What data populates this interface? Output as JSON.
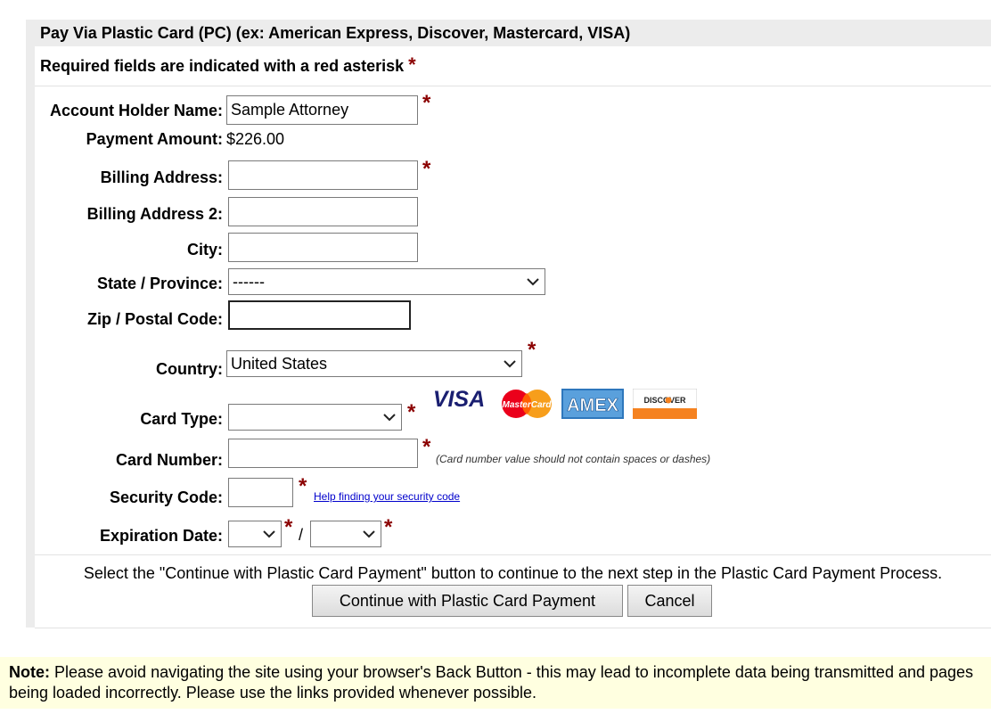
{
  "header": {
    "title": "Pay Via Plastic Card (PC) (ex: American Express, Discover, Mastercard, VISA)"
  },
  "required_note": "Required fields are indicated with a red asterisk",
  "asterisk": "*",
  "fields": {
    "account_holder": {
      "label": "Account Holder Name:",
      "value": "Sample Attorney"
    },
    "payment_amount": {
      "label": "Payment Amount:",
      "value": "$226.00"
    },
    "billing_address": {
      "label": "Billing Address:",
      "value": ""
    },
    "billing_address2": {
      "label": "Billing Address 2:",
      "value": ""
    },
    "city": {
      "label": "City:",
      "value": ""
    },
    "state": {
      "label": "State / Province:",
      "value": "------"
    },
    "zip": {
      "label": "Zip / Postal Code:",
      "value": ""
    },
    "country": {
      "label": "Country:",
      "value": "United States"
    },
    "card_type": {
      "label": "Card Type:",
      "value": ""
    },
    "card_number": {
      "label": "Card Number:",
      "value": "",
      "hint": "(Card number value should not contain spaces or dashes)"
    },
    "security_code": {
      "label": "Security Code:",
      "value": "",
      "help_link": "Help finding your security code"
    },
    "expiration": {
      "label": "Expiration Date:",
      "month": "",
      "year": "",
      "separator": "/"
    }
  },
  "card_logos": {
    "visa": "VISA",
    "mastercard": "MasterCard",
    "amex": "AMEX",
    "discover": "DISCOVER"
  },
  "instructions": "Select the \"Continue with Plastic Card Payment\" button to continue to the next step in the Plastic Card Payment Process.",
  "buttons": {
    "continue": "Continue with Plastic Card Payment",
    "cancel": "Cancel"
  },
  "note": {
    "prefix": "Note:",
    "text": " Please avoid navigating the site using your browser's Back Button - this may lead to incomplete data being transmitted and pages being loaded incorrectly. Please use the links provided whenever possible."
  },
  "colors": {
    "asterisk": "#8b0000",
    "note_bg": "#ffffe0",
    "header_bg": "#ececec",
    "link": "#0000cc"
  }
}
